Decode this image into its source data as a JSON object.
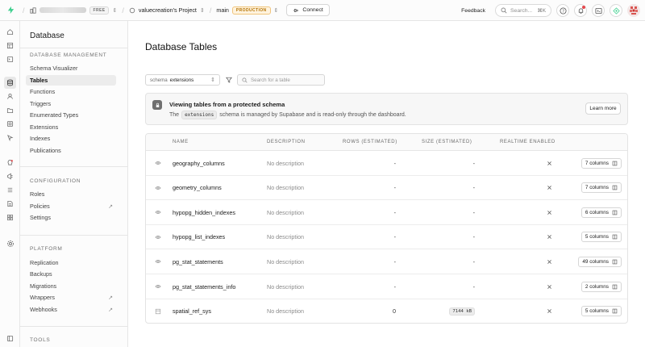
{
  "topbar": {
    "org_badge": "FREE",
    "project_name": "valuecreation's Project",
    "branch_name": "main",
    "env_badge": "PRODUCTION",
    "connect_label": "Connect",
    "feedback_label": "Feedback",
    "search_placeholder": "Search...",
    "search_shortcut": "⌘K"
  },
  "menu": {
    "title": "Database",
    "sections": [
      {
        "label": "DATABASE MANAGEMENT",
        "items": [
          "Schema Visualizer",
          "Tables",
          "Functions",
          "Triggers",
          "Enumerated Types",
          "Extensions",
          "Indexes",
          "Publications"
        ]
      },
      {
        "label": "CONFIGURATION",
        "items": [
          "Roles",
          "Policies",
          "Settings"
        ]
      },
      {
        "label": "PLATFORM",
        "items": [
          "Replication",
          "Backups",
          "Migrations",
          "Wrappers",
          "Webhooks"
        ]
      },
      {
        "label": "TOOLS",
        "items": []
      }
    ],
    "active_item": "Tables"
  },
  "main": {
    "title": "Database Tables",
    "schema_label": "schema",
    "schema_value": "extensions",
    "search_placeholder": "Search for a table",
    "notice": {
      "title": "Viewing tables from a protected schema",
      "body_pre": "The",
      "schema_code": "extensions",
      "body_post": "schema is managed by Supabase and is read-only through the dashboard.",
      "button": "Learn more"
    },
    "table": {
      "headers": [
        "NAME",
        "DESCRIPTION",
        "ROWS (ESTIMATED)",
        "SIZE (ESTIMATED)",
        "REALTIME ENABLED"
      ],
      "rows": [
        {
          "type": "view",
          "name": "geography_columns",
          "description": "No description",
          "rows": "-",
          "size": "-",
          "columns": "7 columns"
        },
        {
          "type": "view",
          "name": "geometry_columns",
          "description": "No description",
          "rows": "-",
          "size": "-",
          "columns": "7 columns"
        },
        {
          "type": "view",
          "name": "hypopg_hidden_indexes",
          "description": "No description",
          "rows": "-",
          "size": "-",
          "columns": "6 columns"
        },
        {
          "type": "view",
          "name": "hypopg_list_indexes",
          "description": "No description",
          "rows": "-",
          "size": "-",
          "columns": "5 columns"
        },
        {
          "type": "view",
          "name": "pg_stat_statements",
          "description": "No description",
          "rows": "-",
          "size": "-",
          "columns": "49 columns"
        },
        {
          "type": "view",
          "name": "pg_stat_statements_info",
          "description": "No description",
          "rows": "-",
          "size": "-",
          "columns": "2 columns"
        },
        {
          "type": "table",
          "name": "spatial_ref_sys",
          "description": "No description",
          "rows": "0",
          "size": "7144 kB",
          "columns": "5 columns"
        }
      ]
    }
  },
  "colors": {
    "brand_green": "#3ecf8e",
    "production_badge": "#b37200"
  }
}
